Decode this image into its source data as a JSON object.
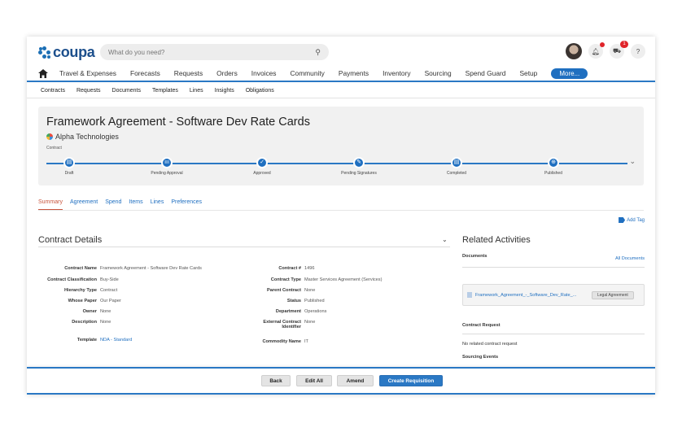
{
  "app": {
    "brand": "coupa",
    "search_placeholder": "What do you need?",
    "cart_badge": "1",
    "help_label": "?"
  },
  "main_nav": [
    "Travel & Expenses",
    "Forecasts",
    "Requests",
    "Orders",
    "Invoices",
    "Community",
    "Payments",
    "Inventory",
    "Sourcing",
    "Spend Guard",
    "Setup"
  ],
  "more_label": "More...",
  "sub_nav": [
    "Contracts",
    "Requests",
    "Documents",
    "Templates",
    "Lines",
    "Insights",
    "Obligations"
  ],
  "header": {
    "title": "Framework Agreement - Software Dev Rate Cards",
    "supplier": "Alpha Technologies",
    "type": "Contract",
    "steps": [
      {
        "label": "Draft",
        "icon": "document-icon",
        "glyph": "▤"
      },
      {
        "label": "Pending Approval",
        "icon": "users-icon",
        "glyph": "ııı"
      },
      {
        "label": "Approved",
        "icon": "check-icon",
        "glyph": "✓"
      },
      {
        "label": "Pending Signatures",
        "icon": "pen-icon",
        "glyph": "✎"
      },
      {
        "label": "Completed",
        "icon": "document-icon",
        "glyph": "▤"
      },
      {
        "label": "Published",
        "icon": "globe-icon",
        "glyph": "⊕"
      }
    ]
  },
  "tabs": [
    "Summary",
    "Agreement",
    "Spend",
    "Items",
    "Lines",
    "Preferences"
  ],
  "add_tag": "Add Tag",
  "contract_details": {
    "title": "Contract Details",
    "left_fields": [
      {
        "label": "Contract Name",
        "value": "Framework Agreement - Software Dev Rate Cards"
      },
      {
        "label": "Contract Classification",
        "value": "Buy-Side"
      },
      {
        "label": "Hierarchy Type",
        "value": "Contract"
      },
      {
        "label": "Whose Paper",
        "value": "Our Paper"
      },
      {
        "label": "Owner",
        "value": "None"
      },
      {
        "label": "Description",
        "value": "None"
      },
      {
        "label": "Template",
        "value": "NDA - Standard"
      }
    ],
    "right_fields": [
      {
        "label": "Contract #",
        "value": "1496"
      },
      {
        "label": "Contract Type",
        "value": "Master Services Agreement (Services)"
      },
      {
        "label": "Parent Contract",
        "value": "None"
      },
      {
        "label": "Status",
        "value": "Published"
      },
      {
        "label": "Department",
        "value": "Operations"
      },
      {
        "label": "External Contract",
        "label2": "Identifier",
        "value": "None"
      },
      {
        "label": "Commodity Name",
        "value": "IT"
      }
    ]
  },
  "related": {
    "title": "Related Activities",
    "documents_label": "Documents",
    "all_documents": "All Documents",
    "doc_name": "Framework_Agreement_-_Software_Dev_Rate_...",
    "doc_badge": "Legal Agreement",
    "contract_request_label": "Contract Request",
    "no_request": "No related contract request",
    "sourcing_events_label": "Sourcing Events"
  },
  "footer": {
    "back": "Back",
    "edit_all": "Edit All",
    "amend": "Amend",
    "create_req": "Create Requisition"
  },
  "colors": {
    "accent": "#2a78c4",
    "active_tab": "#c8553d"
  }
}
